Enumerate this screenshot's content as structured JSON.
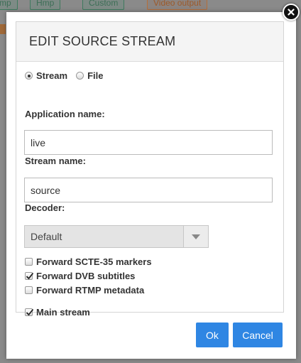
{
  "background_toolbar": {
    "buttons": [
      "mp",
      "Hmp",
      "Custom",
      "Video output"
    ]
  },
  "dialog": {
    "title": "EDIT SOURCE STREAM",
    "source_type": {
      "options": [
        "Stream",
        "File"
      ],
      "selected": "Stream"
    },
    "application_name": {
      "label": "Application name:",
      "value": "live"
    },
    "stream_name": {
      "label": "Stream name:",
      "value": "source"
    },
    "decoder": {
      "label": "Decoder:",
      "selected": "Default"
    },
    "checkboxes": [
      {
        "label": "Forward SCTE-35 markers",
        "checked": false
      },
      {
        "label": "Forward DVB subtitles",
        "checked": true
      },
      {
        "label": "Forward RTMP metadata",
        "checked": false
      },
      {
        "label": "Main stream",
        "checked": true
      }
    ],
    "buttons": {
      "ok": "Ok",
      "cancel": "Cancel"
    }
  },
  "colors": {
    "primary_button": "#2f86e3",
    "overlay": "#8a8a8a"
  }
}
